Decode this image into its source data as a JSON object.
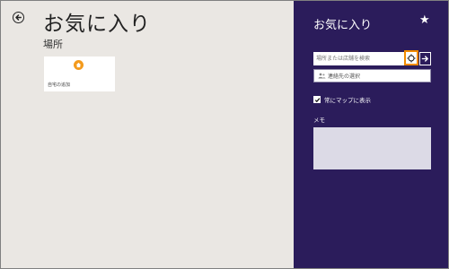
{
  "header": {
    "title": "お気に入り",
    "back_icon": "back-arrow-icon"
  },
  "places": {
    "section_label": "場所",
    "tile": {
      "label": "自宅の追加",
      "icon": "home-icon",
      "icon_color": "#f39a1c"
    }
  },
  "pane": {
    "title": "お気に入り",
    "star_glyph": "★",
    "search": {
      "placeholder": "場所または店舗を検索",
      "value": ""
    },
    "locate_icon": "crosshair-icon",
    "go_icon": "arrow-right-icon",
    "contact": {
      "icon": "contacts-icon",
      "label": "連絡先の選択"
    },
    "show_on_map": {
      "label": "常にマップに表示",
      "checked": true
    },
    "memo": {
      "label": "メモ",
      "value": ""
    }
  },
  "colors": {
    "pane_background": "#2b1c5b",
    "app_background": "#eae7e3",
    "highlight": "#f28b00"
  }
}
